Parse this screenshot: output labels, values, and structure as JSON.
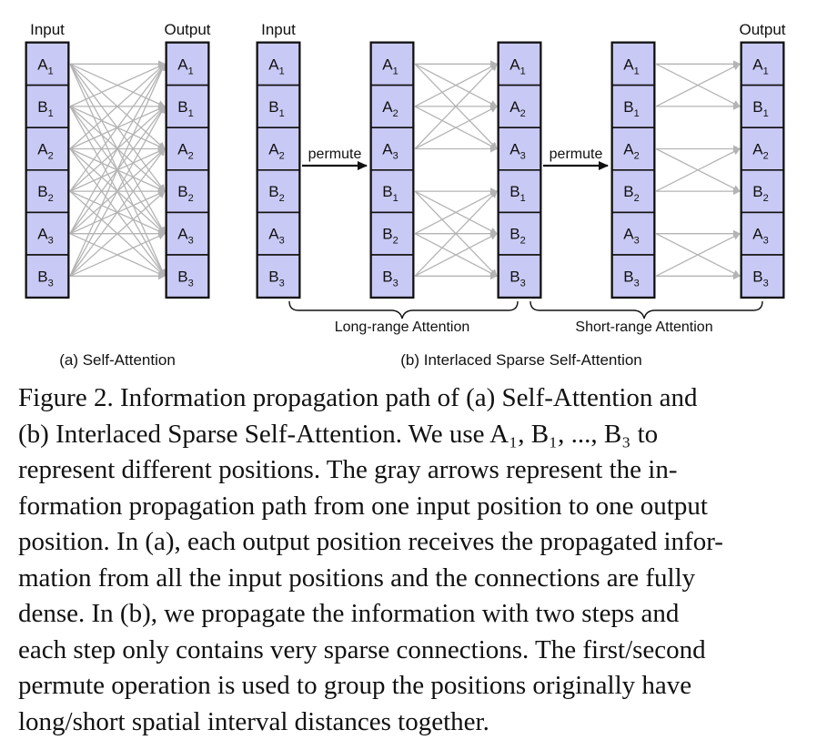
{
  "figure": {
    "input_label": "Input",
    "output_label": "Output",
    "permute_label": "permute",
    "long_range_label": "Long-range Attention",
    "short_range_label": "Short-range Attention",
    "subcaption_a": "(a) Self-Attention",
    "subcaption_b": "(b) Interlaced Sparse Self-Attention",
    "columns": {
      "a_input": [
        [
          "A",
          "1"
        ],
        [
          "B",
          "1"
        ],
        [
          "A",
          "2"
        ],
        [
          "B",
          "2"
        ],
        [
          "A",
          "3"
        ],
        [
          "B",
          "3"
        ]
      ],
      "a_output": [
        [
          "A",
          "1"
        ],
        [
          "B",
          "1"
        ],
        [
          "A",
          "2"
        ],
        [
          "B",
          "2"
        ],
        [
          "A",
          "3"
        ],
        [
          "B",
          "3"
        ]
      ],
      "b_input": [
        [
          "A",
          "1"
        ],
        [
          "B",
          "1"
        ],
        [
          "A",
          "2"
        ],
        [
          "B",
          "2"
        ],
        [
          "A",
          "3"
        ],
        [
          "B",
          "3"
        ]
      ],
      "b_perm1": [
        [
          "A",
          "1"
        ],
        [
          "A",
          "2"
        ],
        [
          "A",
          "3"
        ],
        [
          "B",
          "1"
        ],
        [
          "B",
          "2"
        ],
        [
          "B",
          "3"
        ]
      ],
      "b_mid": [
        [
          "A",
          "1"
        ],
        [
          "A",
          "2"
        ],
        [
          "A",
          "3"
        ],
        [
          "B",
          "1"
        ],
        [
          "B",
          "2"
        ],
        [
          "B",
          "3"
        ]
      ],
      "b_perm2": [
        [
          "A",
          "1"
        ],
        [
          "B",
          "1"
        ],
        [
          "A",
          "2"
        ],
        [
          "B",
          "2"
        ],
        [
          "A",
          "3"
        ],
        [
          "B",
          "3"
        ]
      ],
      "b_output": [
        [
          "A",
          "1"
        ],
        [
          "B",
          "1"
        ],
        [
          "A",
          "2"
        ],
        [
          "B",
          "2"
        ],
        [
          "A",
          "3"
        ],
        [
          "B",
          "3"
        ]
      ]
    },
    "colors": {
      "cell_fill": "#c9c9f5",
      "cell_border": "#111111",
      "arrow": "#b4b4b4",
      "permute_arrow": "#111111"
    }
  },
  "caption": {
    "lines": [
      "Figure 2.  Information propagation path of (a) Self-Attention and",
      "(b) Interlaced Sparse Self-Attention.  We use A₁, B₁, ..., B₃ to",
      "represent different positions.  The gray arrows represent the in-",
      "formation propagation path from one input position to one output",
      "position. In (a), each output position receives the propagated infor-",
      "mation from all the input positions and the connections are fully",
      "dense.  In (b), we propagate the information with two steps and",
      "each step only contains very sparse connections. The first/second",
      "permute operation is used to group the positions originally have",
      "long/short spatial interval distances together."
    ]
  }
}
